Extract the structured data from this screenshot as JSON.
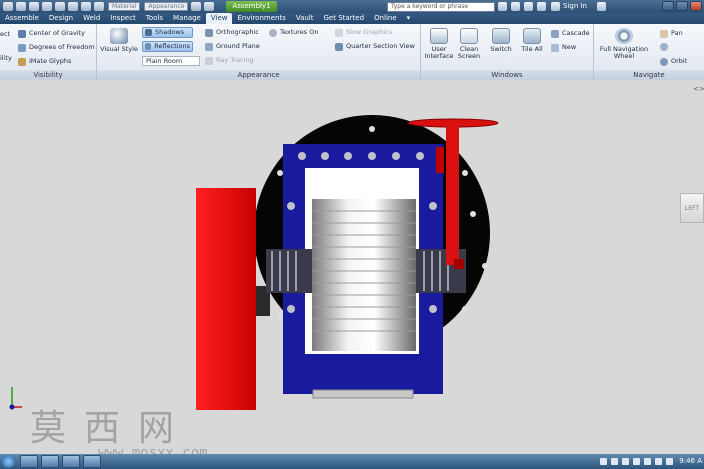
{
  "qat": {
    "material_placeholder": "Material",
    "appearance_placeholder": "Appearance",
    "document_tab": "Assembly1",
    "search_placeholder": "Type a keyword or phrase",
    "sign_in": "Sign In"
  },
  "tabs": [
    "Assemble",
    "Design",
    "Weld",
    "Inspect",
    "Tools",
    "Manage",
    "View",
    "Environments",
    "Vault",
    "Get Started",
    "Online"
  ],
  "active_tab": "View",
  "ribbon": {
    "visibility": {
      "title": "Visibility",
      "partial_top": "ect",
      "partial_bottom": "ility",
      "items": [
        "Center of Gravity",
        "Degrees of Freedom",
        "iMate Glyphs"
      ]
    },
    "appearance": {
      "title": "Appearance",
      "visual_style": "Visual Style",
      "shadows": "Shadows",
      "reflections": "Reflections",
      "environment_value": "Plain Room",
      "orthographic": "Orthographic",
      "ground_plane": "Ground Plane",
      "ray_tracing": "Ray Tracing",
      "textures_on": "Textures On",
      "slow_graphics": "Slow Graphics",
      "quarter_section_view": "Quarter Section View"
    },
    "windows": {
      "title": "Windows",
      "user_interface": "User Interface",
      "clean_screen": "Clean Screen",
      "switch": "Switch",
      "tile_all": "Tile All",
      "cascade": "Cascade",
      "new": "New"
    },
    "navigate": {
      "title": "Navigate",
      "full_navigation_wheel": "Full Navigation Wheel",
      "pan": "Pan",
      "orbit": "Orbit"
    }
  },
  "viewport": {
    "viewcube_label": "LEFT",
    "watermark": "莫西网",
    "watermark_url": "www.mosxx.com"
  },
  "taskbar": {
    "clock": "9:46 A"
  },
  "colors": {
    "model_blue": "#1a1a9e",
    "model_red": "#e01010",
    "ribbon_dark": "#2d4f74"
  }
}
